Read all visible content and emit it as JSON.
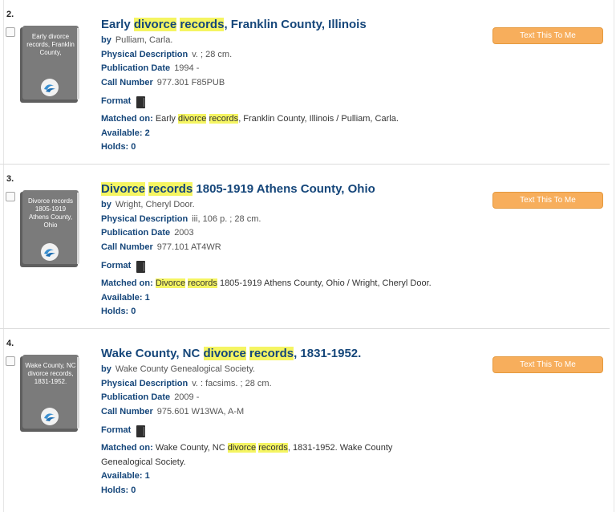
{
  "results": [
    {
      "number": "2.",
      "cover_text": "Early divorce records, Franklin County,",
      "title": {
        "pre": "Early ",
        "h1": "divorce",
        "mid": " ",
        "h2": "records",
        "post": ", Franklin County, Illinois"
      },
      "by_label": "by",
      "by_value": "Pulliam, Carla.",
      "phys_label": "Physical Description",
      "phys_value": "v. ; 28 cm.",
      "pub_label": "Publication Date",
      "pub_value": "1994 -",
      "call_label": "Call Number",
      "call_value": "977.301 F85PUB",
      "format_label": "Format",
      "matched_label": "Matched on:",
      "matched": {
        "pre": " Early ",
        "h1": "divorce",
        "mid": " ",
        "h2": "records",
        "post": ", Franklin County, Illinois / Pulliam, Carla."
      },
      "available": "Available: 2",
      "holds": "Holds: 0",
      "button": "Text This To Me"
    },
    {
      "number": "3.",
      "cover_text": "Divorce records 1805-1919 Athens County, Ohio",
      "title": {
        "pre": "",
        "h1": "Divorce",
        "mid": " ",
        "h2": "records",
        "post": " 1805-1919 Athens County, Ohio"
      },
      "by_label": "by",
      "by_value": "Wright, Cheryl Door.",
      "phys_label": "Physical Description",
      "phys_value": "iii, 106 p. ; 28 cm.",
      "pub_label": "Publication Date",
      "pub_value": "2003",
      "call_label": "Call Number",
      "call_value": "977.101 AT4WR",
      "format_label": "Format",
      "matched_label": "Matched on:",
      "matched": {
        "pre": " ",
        "h1": "Divorce",
        "mid": " ",
        "h2": "records",
        "post": " 1805-1919 Athens County, Ohio / Wright, Cheryl Door."
      },
      "available": "Available: 1",
      "holds": "Holds: 0",
      "button": "Text This To Me"
    },
    {
      "number": "4.",
      "cover_text": "Wake County, NC divorce records, 1831-1952.",
      "title": {
        "pre": "Wake County, NC ",
        "h1": "divorce",
        "mid": " ",
        "h2": "records",
        "post": ", 1831-1952."
      },
      "by_label": "by",
      "by_value": "Wake County Genealogical Society.",
      "phys_label": "Physical Description",
      "phys_value": "v. : facsims. ; 28 cm.",
      "pub_label": "Publication Date",
      "pub_value": "2009 -",
      "call_label": "Call Number",
      "call_value": "975.601 W13WA, A-M",
      "format_label": "Format",
      "matched_label": "Matched on:",
      "matched": {
        "pre": " Wake County, NC ",
        "h1": "divorce",
        "mid": " ",
        "h2": "records",
        "post": ", 1831-1952. Wake County Genealogical Society."
      },
      "available": "Available: 1",
      "holds": "Holds: 0",
      "button": "Text This To Me"
    }
  ],
  "icons": {
    "format": "book-icon",
    "cover_logo": "wave-logo-icon"
  },
  "colors": {
    "title": "#15467a",
    "highlight": "#f5f562",
    "button": "#f7ae5c",
    "cover": "#7b7b7b"
  }
}
